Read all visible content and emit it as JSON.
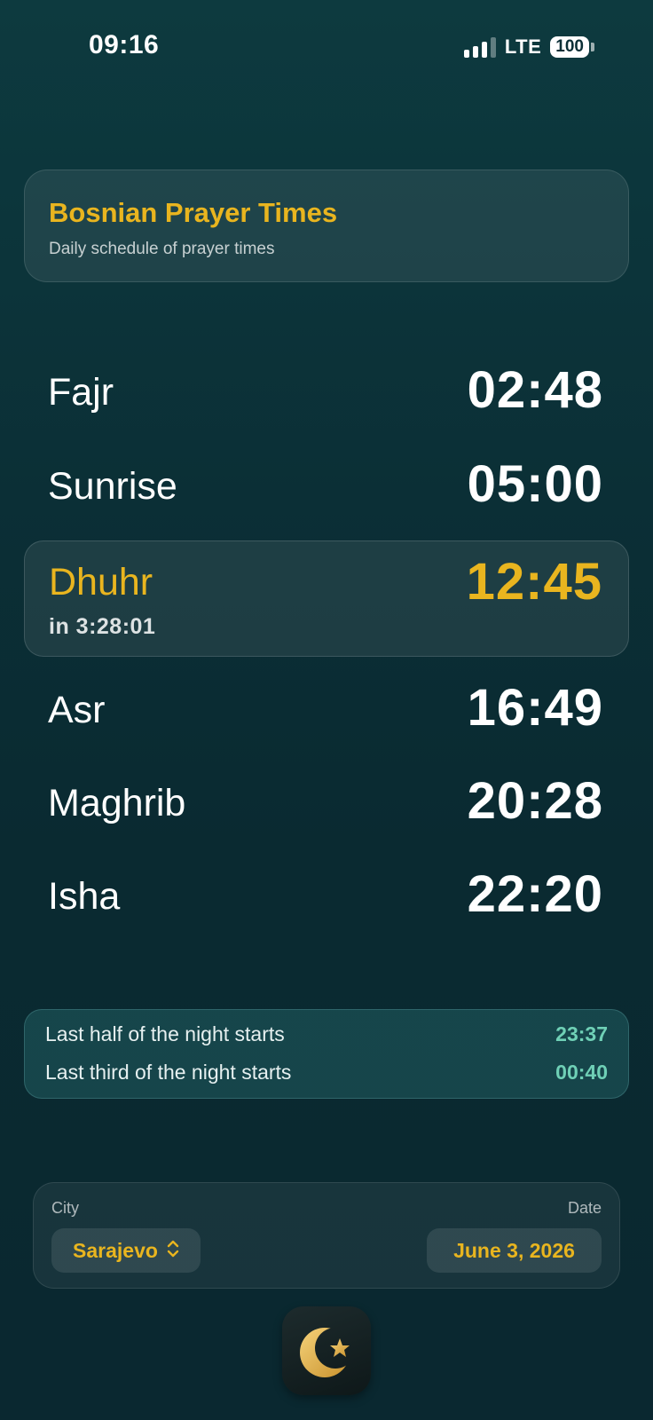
{
  "status_bar": {
    "time": "09:16",
    "network": "LTE",
    "battery": "100"
  },
  "header": {
    "title": "Bosnian Prayer Times",
    "subtitle": "Daily schedule of prayer times"
  },
  "prayers": [
    {
      "name": "Fajr",
      "time": "02:48"
    },
    {
      "name": "Sunrise",
      "time": "05:00"
    },
    {
      "name": "Dhuhr",
      "time": "12:45",
      "countdown": "in 3:28:01",
      "active": true
    },
    {
      "name": "Asr",
      "time": "16:49"
    },
    {
      "name": "Maghrib",
      "time": "20:28"
    },
    {
      "name": "Isha",
      "time": "22:20"
    }
  ],
  "night": {
    "half_label": "Last half of the night starts",
    "half_time": "23:37",
    "third_label": "Last third of the night starts",
    "third_time": "00:40"
  },
  "controls": {
    "city_label": "City",
    "city_value": "Sarajevo",
    "date_label": "Date",
    "date_value": "June 3, 2026"
  },
  "colors": {
    "accent": "#e9b51f",
    "night_time": "#6fd0b6",
    "background": "#0b2f36"
  },
  "icons": {
    "app_icon": "crescent-star-icon",
    "city_picker": "chevron-up-down-icon"
  }
}
